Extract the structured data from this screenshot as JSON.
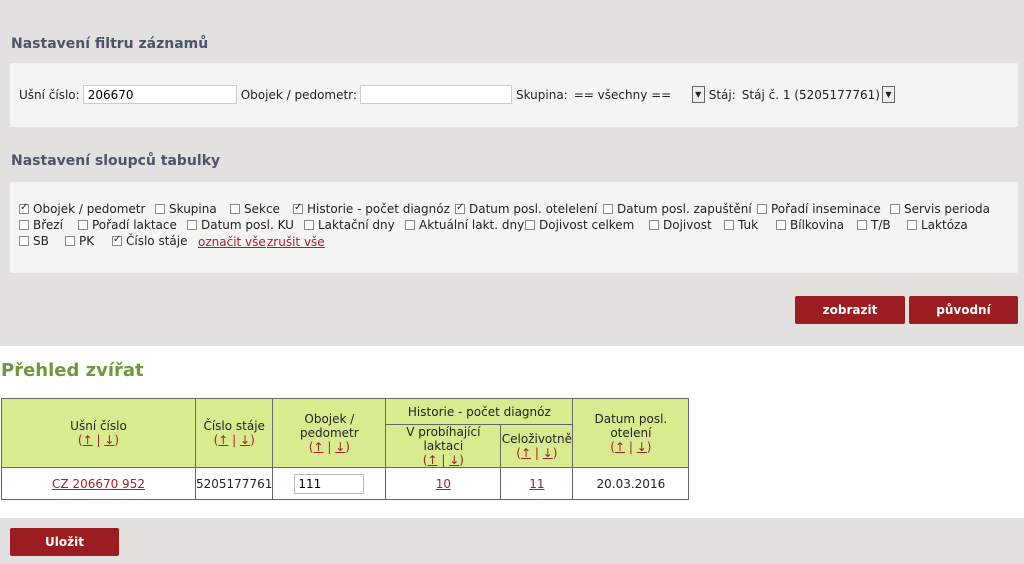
{
  "filter": {
    "title": "Nastavení filtru záznamů",
    "ear_label": "Ušní číslo:",
    "ear_value": "206670",
    "collar_label": "Obojek / pedometr:",
    "collar_value": "",
    "group_label": "Skupina:",
    "group_value": "== všechny ==",
    "stable_label": "Stáj:",
    "stable_value": "Stáj č. 1 (5205177761)"
  },
  "columns": {
    "title": "Nastavení sloupců tabulky",
    "items": [
      {
        "label": "Obojek / pedometr",
        "checked": true
      },
      {
        "label": "Skupina",
        "checked": false
      },
      {
        "label": "Sekce",
        "checked": false
      },
      {
        "label": "Historie - počet diagnóz",
        "checked": true
      },
      {
        "label": "Datum posl. otelelení",
        "checked": true
      },
      {
        "label": "Datum posl. zapuštění",
        "checked": false
      },
      {
        "label": "Pořadí inseminace",
        "checked": false
      },
      {
        "label": "Servis perioda",
        "checked": false
      },
      {
        "label": "Březí",
        "checked": false
      },
      {
        "label": "Pořadí laktace",
        "checked": false
      },
      {
        "label": "Datum posl. KU",
        "checked": false
      },
      {
        "label": "Laktační dny",
        "checked": false
      },
      {
        "label": "Aktuální lakt. dny",
        "checked": false
      },
      {
        "label": "Dojivost celkem",
        "checked": false
      },
      {
        "label": "Dojivost",
        "checked": false
      },
      {
        "label": "Tuk",
        "checked": false
      },
      {
        "label": "Bílkovina",
        "checked": false
      },
      {
        "label": "T/B",
        "checked": false
      },
      {
        "label": "Laktóza",
        "checked": false
      },
      {
        "label": "SB",
        "checked": false
      },
      {
        "label": "PK",
        "checked": false
      },
      {
        "label": "Číslo stáje",
        "checked": true
      }
    ],
    "select_all": "označit vše",
    "deselect_all": "zrušit vše",
    "show_button": "zobrazit",
    "original_button": "původní"
  },
  "overview": {
    "title": "Přehled zvířat",
    "headers": {
      "ear": "Ušní číslo",
      "stable": "Číslo stáje",
      "collar": "Obojek / pedometr",
      "history": "Historie - počet diagnóz",
      "current_lactation": "V probíhající laktaci",
      "lifetime": "Celoživotně",
      "last_calving": "Datum posl. otelení"
    },
    "sort_up": "↑",
    "sort_sep": "|",
    "sort_down": "↓",
    "row": {
      "ear": "CZ 206670 952",
      "stable": "5205177761",
      "collar": "111",
      "current_lactation": "10",
      "lifetime": "11",
      "last_calving": "20.03.2016"
    }
  },
  "save_button": "Uložit"
}
